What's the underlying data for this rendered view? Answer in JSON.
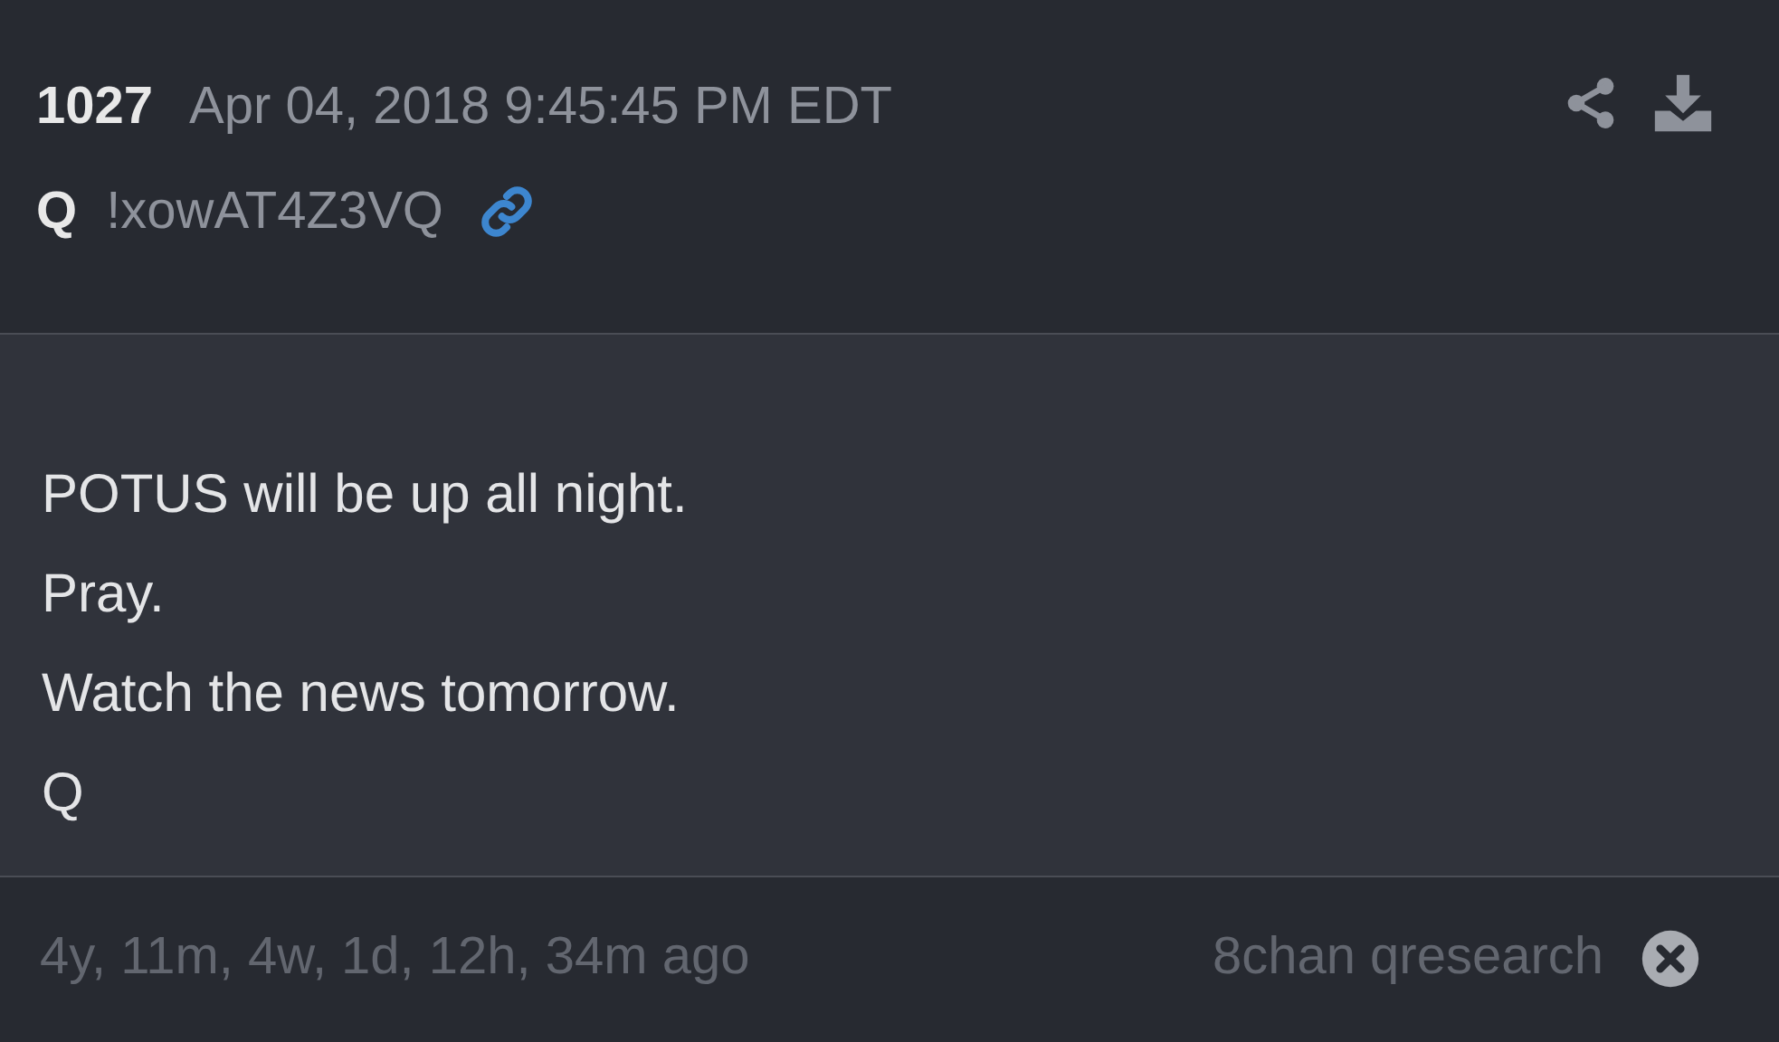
{
  "post": {
    "number": "1027",
    "timestamp": "Apr 04, 2018 9:45:45 PM EDT",
    "author": "Q",
    "tripcode": "!xowAT4Z3VQ"
  },
  "body": {
    "lines": [
      "POTUS will be up all night.",
      "Pray.",
      "Watch the news tomorrow.",
      "Q"
    ]
  },
  "footer": {
    "age": "4y, 11m, 4w, 1d, 12h, 34m ago",
    "source": "8chan qresearch"
  }
}
